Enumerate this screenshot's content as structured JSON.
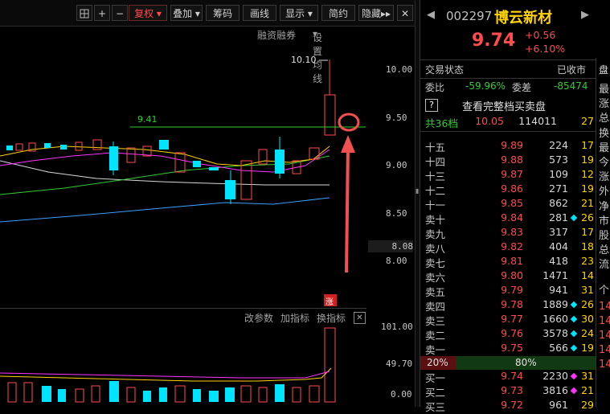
{
  "toolbar": {
    "fuquan": "复权",
    "diejia": "叠加",
    "chouma": "筹码",
    "huaxian": "画线",
    "xianshi": "显示",
    "jianyue": "简约",
    "yincang": "隐藏"
  },
  "chart": {
    "rongzi": "融资融券",
    "shezhi_junxian": "设置均线",
    "price_axis": [
      "10.00",
      "9.50",
      "9.00",
      "8.50",
      "8.08",
      "8.00"
    ],
    "high_label": "10.10",
    "line_label": "9.41",
    "zhang_badge": "涨",
    "indicator_bar": {
      "gai_canshu": "改参数",
      "jia_zhibiao": "加指标",
      "huan_zhibiao": "换指标"
    },
    "volume_axis": [
      "101.00",
      "49.70",
      "0.00"
    ]
  },
  "quote": {
    "code": "002297",
    "name": "博云新材",
    "price": "9.74",
    "change": "+0.56",
    "pct": "+6.10%",
    "status_label": "交易状态",
    "status_value": "已收市",
    "weibi_label": "委比",
    "weibi_value": "-59.96%",
    "weicha_label": "委差",
    "weicha_value": "-85474",
    "full_book_label": "查看完整档买卖盘",
    "total_levels": {
      "label": "共36档",
      "price": "10.05",
      "vol": "114011",
      "count": "27"
    },
    "sell_levels": [
      {
        "label": "十五",
        "price": "9.89",
        "vol": "224",
        "count": "17",
        "mark": ""
      },
      {
        "label": "十四",
        "price": "9.88",
        "vol": "573",
        "count": "19",
        "mark": ""
      },
      {
        "label": "十三",
        "price": "9.87",
        "vol": "109",
        "count": "12",
        "mark": ""
      },
      {
        "label": "十二",
        "price": "9.86",
        "vol": "271",
        "count": "19",
        "mark": ""
      },
      {
        "label": "十一",
        "price": "9.85",
        "vol": "862",
        "count": "21",
        "mark": ""
      },
      {
        "label": "卖十",
        "price": "9.84",
        "vol": "281",
        "count": "26",
        "mark": "#00e5ff"
      },
      {
        "label": "卖九",
        "price": "9.83",
        "vol": "317",
        "count": "17",
        "mark": ""
      },
      {
        "label": "卖八",
        "price": "9.82",
        "vol": "404",
        "count": "18",
        "mark": ""
      },
      {
        "label": "卖七",
        "price": "9.81",
        "vol": "418",
        "count": "23",
        "mark": ""
      },
      {
        "label": "卖六",
        "price": "9.80",
        "vol": "1471",
        "count": "14",
        "mark": ""
      },
      {
        "label": "卖五",
        "price": "9.79",
        "vol": "941",
        "count": "31",
        "mark": ""
      },
      {
        "label": "卖四",
        "price": "9.78",
        "vol": "1889",
        "count": "26",
        "mark": "#00e5ff"
      },
      {
        "label": "卖三",
        "price": "9.77",
        "vol": "1660",
        "count": "30",
        "mark": "#00e5ff"
      },
      {
        "label": "卖二",
        "price": "9.76",
        "vol": "3578",
        "count": "24",
        "mark": "#00e5ff"
      },
      {
        "label": "卖一",
        "price": "9.75",
        "vol": "566",
        "count": "19",
        "mark": "#00e5ff"
      }
    ],
    "ratio_bar": {
      "left": "20%",
      "right": "80%"
    },
    "buy_levels": [
      {
        "label": "买一",
        "price": "9.74",
        "vol": "2230",
        "count": "31",
        "mark": "#ff33ff"
      },
      {
        "label": "买二",
        "price": "9.73",
        "vol": "3816",
        "count": "21",
        "mark": "#ff33ff"
      },
      {
        "label": "买三",
        "price": "9.72",
        "vol": "961",
        "count": "29",
        "mark": ""
      }
    ]
  },
  "side_strip": {
    "header": "盘",
    "chars": [
      "最",
      "涨",
      "总",
      "换",
      "最",
      "今",
      "涨",
      "外",
      "净",
      "市",
      "股",
      "总",
      "流"
    ],
    "sub_header": "个",
    "values": [
      "14",
      "14",
      "14",
      "14",
      "14"
    ]
  },
  "colors": {
    "up": "#ff4b4b",
    "down": "#00e5ff",
    "green": "#33cc33",
    "yellow": "#ffd400",
    "magenta": "#ff33ff",
    "annotation": "#f05050"
  }
}
